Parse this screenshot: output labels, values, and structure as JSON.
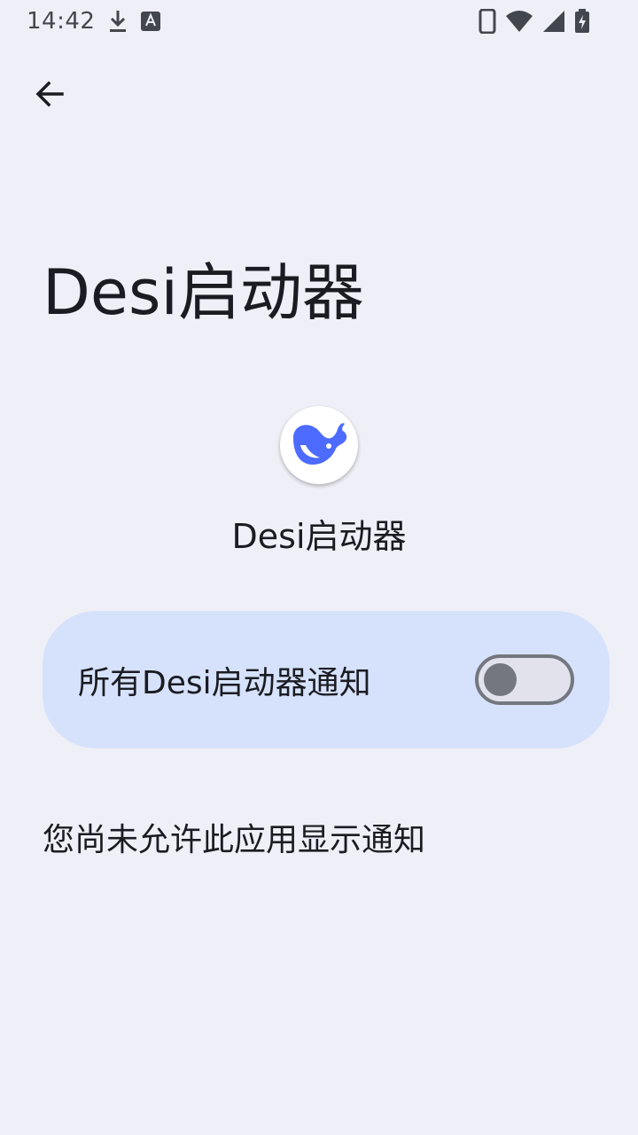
{
  "status_bar": {
    "time": "14:42",
    "icons": [
      "download-icon",
      "keyboard-a-icon",
      "phone-icon",
      "wifi-icon",
      "signal-icon",
      "battery-charging-icon"
    ]
  },
  "header": {
    "back_icon": "arrow-left-icon"
  },
  "page": {
    "title": "Desi启动器",
    "app_name": "Desi启动器",
    "app_icon": "deepseek-whale-icon"
  },
  "notifications": {
    "label": "所有Desi启动器通知",
    "enabled": false
  },
  "note": "您尚未允许此应用显示通知",
  "colors": {
    "background": "#eff0f7",
    "card": "#d6e2fb",
    "toggle_track": "#e1e2ec",
    "toggle_outline": "#74777f",
    "icon_brand": "#4d6bfe"
  }
}
